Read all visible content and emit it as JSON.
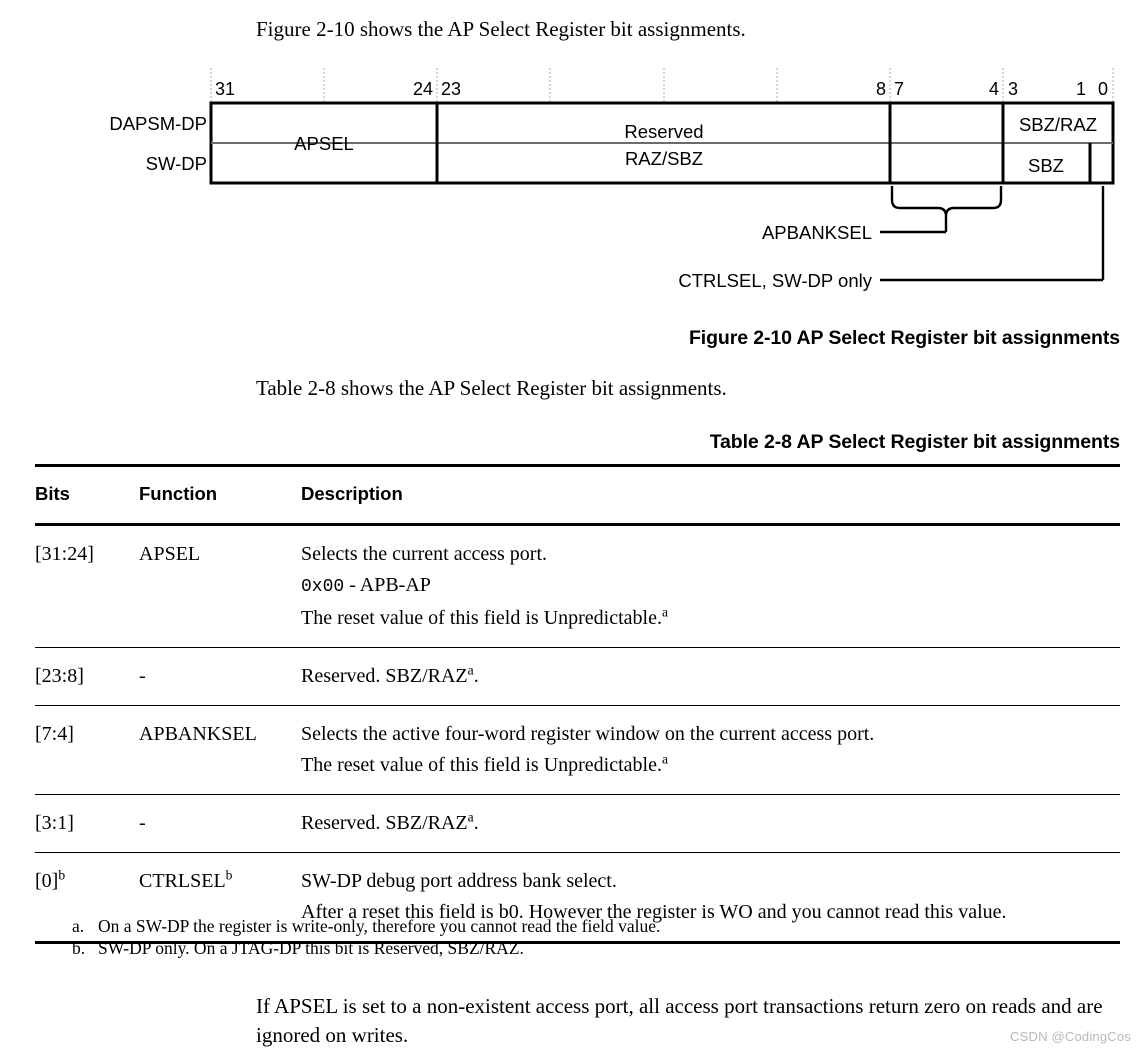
{
  "page": {
    "intro_figure": "Figure 2-10 shows the AP Select Register bit assignments.",
    "intro_table": "Table 2-8 shows the AP Select Register bit assignments.",
    "figure_caption": "Figure 2-10 AP Select Register bit assignments",
    "table_caption": "Table 2-8 AP Select Register bit assignments",
    "closing_paragraph": "If APSEL is set to a non-existent access port, all access port transactions return zero on reads and are ignored on writes.",
    "watermark": "CSDN @CodingCos"
  },
  "figure": {
    "row_labels": [
      "DAPSM-DP",
      "SW-DP"
    ],
    "bit_numbers": [
      "31",
      "24",
      "23",
      "8",
      "7",
      "4",
      "3",
      "1",
      "0"
    ],
    "fields": {
      "apsel": "APSEL",
      "reserved_line1": "Reserved",
      "reserved_line2": "RAZ/SBZ",
      "sbz_raz": "SBZ/RAZ",
      "sbz": "SBZ"
    },
    "callouts": [
      "APBANKSEL",
      "CTRLSEL, SW-DP only"
    ]
  },
  "table": {
    "headers": [
      "Bits",
      "Function",
      "Description"
    ],
    "rows": [
      {
        "bits": "[31:24]",
        "bits_sup": "",
        "function": "APSEL",
        "function_sup": "",
        "description": [
          {
            "text": "Selects the current access port.",
            "mono_prefix": "",
            "sup": ""
          },
          {
            "text": " - APB-AP",
            "mono_prefix": "0x00",
            "sup": ""
          },
          {
            "text": "The reset value of this field is Unpredictable.",
            "mono_prefix": "",
            "sup": "a"
          }
        ]
      },
      {
        "bits": "[23:8]",
        "bits_sup": "",
        "function": "-",
        "function_sup": "",
        "description": [
          {
            "text": "Reserved. SBZ/RAZ",
            "mono_prefix": "",
            "sup": "a",
            "suffix": "."
          }
        ]
      },
      {
        "bits": "[7:4]",
        "bits_sup": "",
        "function": "APBANKSEL",
        "function_sup": "",
        "description": [
          {
            "text": "Selects the active four-word register window on the current access port.",
            "mono_prefix": "",
            "sup": ""
          },
          {
            "text": "The reset value of this field is Unpredictable.",
            "mono_prefix": "",
            "sup": "a"
          }
        ]
      },
      {
        "bits": "[3:1]",
        "bits_sup": "",
        "function": "-",
        "function_sup": "",
        "description": [
          {
            "text": "Reserved. SBZ/RAZ",
            "mono_prefix": "",
            "sup": "a",
            "suffix": "."
          }
        ]
      },
      {
        "bits": "[0]",
        "bits_sup": "b",
        "function": "CTRLSEL",
        "function_sup": "b",
        "description": [
          {
            "text": "SW-DP debug port address bank select.",
            "mono_prefix": "",
            "sup": ""
          },
          {
            "text": "After a reset this field is b0. However the register is WO and you cannot read this value.",
            "mono_prefix": "",
            "sup": ""
          }
        ]
      }
    ]
  },
  "footnotes": [
    {
      "marker": "a.",
      "text": "On a SW-DP the register is write-only, therefore you cannot read the field value."
    },
    {
      "marker": "b.",
      "text": "SW-DP only. On a JTAG-DP this bit is Reserved, SBZ/RAZ."
    }
  ],
  "colors": {
    "text": "#000000",
    "rule": "#000000",
    "inner_rule": "#6b6b6b",
    "tick": "#cccccc",
    "watermark": "#b9b9b9"
  }
}
